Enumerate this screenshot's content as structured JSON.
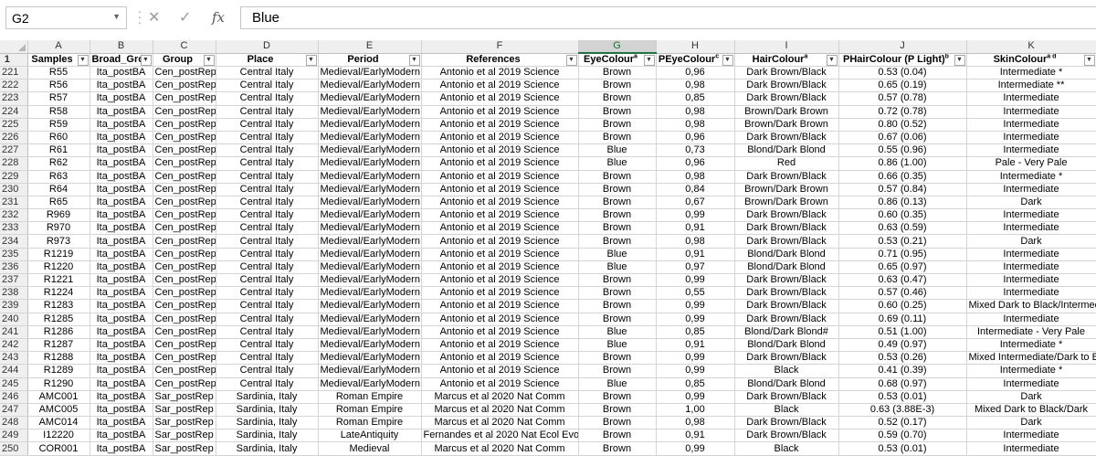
{
  "formula_bar": {
    "name_box": "G2",
    "cancel_icon": "✕",
    "confirm_icon": "✓",
    "fx_label": "fx",
    "value": "Blue"
  },
  "grid": {
    "selected_column": "G",
    "columns": [
      "A",
      "B",
      "C",
      "D",
      "E",
      "F",
      "G",
      "H",
      "I",
      "J",
      "K"
    ],
    "header_row_number": "1",
    "headers": [
      "Samples",
      "Broad_Gro",
      "Group",
      "Place",
      "Period",
      "References",
      "EyeColour",
      "PEyeColour",
      "HairColour",
      "PHairColour (P Light)",
      "SkinColour"
    ],
    "header_superscripts": [
      "",
      "",
      "",
      "",
      "",
      "",
      "a",
      "c",
      "a",
      "b",
      "a d"
    ],
    "rows": [
      [
        "221",
        "R55",
        "Ita_postBA",
        "Cen_postRep",
        "Central Italy",
        "Medieval/EarlyModern",
        "Antonio et al 2019 Science",
        "Brown",
        "0,96",
        "Dark Brown/Black",
        "0.53 (0.04)",
        "Intermediate *"
      ],
      [
        "222",
        "R56",
        "Ita_postBA",
        "Cen_postRep",
        "Central Italy",
        "Medieval/EarlyModern",
        "Antonio et al 2019 Science",
        "Brown",
        "0,98",
        "Dark Brown/Black",
        "0.65 (0.19)",
        "Intermediate **"
      ],
      [
        "223",
        "R57",
        "Ita_postBA",
        "Cen_postRep",
        "Central Italy",
        "Medieval/EarlyModern",
        "Antonio et al 2019 Science",
        "Brown",
        "0,85",
        "Dark Brown/Black",
        "0.57 (0.78)",
        "Intermediate"
      ],
      [
        "224",
        "R58",
        "Ita_postBA",
        "Cen_postRep",
        "Central Italy",
        "Medieval/EarlyModern",
        "Antonio et al 2019 Science",
        "Brown",
        "0,98",
        "Brown/Dark Brown",
        "0.72 (0.78)",
        "Intermediate"
      ],
      [
        "225",
        "R59",
        "Ita_postBA",
        "Cen_postRep",
        "Central Italy",
        "Medieval/EarlyModern",
        "Antonio et al 2019 Science",
        "Brown",
        "0,98",
        "Brown/Dark Brown",
        "0.80 (0.52)",
        "Intermediate"
      ],
      [
        "226",
        "R60",
        "Ita_postBA",
        "Cen_postRep",
        "Central Italy",
        "Medieval/EarlyModern",
        "Antonio et al 2019 Science",
        "Brown",
        "0,96",
        "Dark Brown/Black",
        "0.67 (0.06)",
        "Intermediate"
      ],
      [
        "227",
        "R61",
        "Ita_postBA",
        "Cen_postRep",
        "Central Italy",
        "Medieval/EarlyModern",
        "Antonio et al 2019 Science",
        "Blue",
        "0,73",
        "Blond/Dark Blond",
        "0.55 (0.96)",
        "Intermediate"
      ],
      [
        "228",
        "R62",
        "Ita_postBA",
        "Cen_postRep",
        "Central Italy",
        "Medieval/EarlyModern",
        "Antonio et al 2019 Science",
        "Blue",
        "0,96",
        "Red",
        "0.86 (1.00)",
        "Pale - Very Pale"
      ],
      [
        "229",
        "R63",
        "Ita_postBA",
        "Cen_postRep",
        "Central Italy",
        "Medieval/EarlyModern",
        "Antonio et al 2019 Science",
        "Brown",
        "0,98",
        "Dark Brown/Black",
        "0.66 (0.35)",
        "Intermediate *"
      ],
      [
        "230",
        "R64",
        "Ita_postBA",
        "Cen_postRep",
        "Central Italy",
        "Medieval/EarlyModern",
        "Antonio et al 2019 Science",
        "Brown",
        "0,84",
        "Brown/Dark Brown",
        "0.57 (0.84)",
        "Intermediate"
      ],
      [
        "231",
        "R65",
        "Ita_postBA",
        "Cen_postRep",
        "Central Italy",
        "Medieval/EarlyModern",
        "Antonio et al 2019 Science",
        "Brown",
        "0,67",
        "Brown/Dark Brown",
        "0.86 (0.13)",
        "Dark"
      ],
      [
        "232",
        "R969",
        "Ita_postBA",
        "Cen_postRep",
        "Central Italy",
        "Medieval/EarlyModern",
        "Antonio et al 2019 Science",
        "Brown",
        "0,99",
        "Dark Brown/Black",
        "0.60 (0.35)",
        "Intermediate"
      ],
      [
        "233",
        "R970",
        "Ita_postBA",
        "Cen_postRep",
        "Central Italy",
        "Medieval/EarlyModern",
        "Antonio et al 2019 Science",
        "Brown",
        "0,91",
        "Dark Brown/Black",
        "0.63 (0.59)",
        "Intermediate"
      ],
      [
        "234",
        "R973",
        "Ita_postBA",
        "Cen_postRep",
        "Central Italy",
        "Medieval/EarlyModern",
        "Antonio et al 2019 Science",
        "Brown",
        "0,98",
        "Dark Brown/Black",
        "0.53 (0.21)",
        "Dark"
      ],
      [
        "235",
        "R1219",
        "Ita_postBA",
        "Cen_postRep",
        "Central Italy",
        "Medieval/EarlyModern",
        "Antonio et al 2019 Science",
        "Blue",
        "0,91",
        "Blond/Dark Blond",
        "0.71 (0.95)",
        "Intermediate"
      ],
      [
        "236",
        "R1220",
        "Ita_postBA",
        "Cen_postRep",
        "Central Italy",
        "Medieval/EarlyModern",
        "Antonio et al 2019 Science",
        "Blue",
        "0,97",
        "Blond/Dark Blond",
        "0.65 (0.97)",
        "Intermediate"
      ],
      [
        "237",
        "R1221",
        "Ita_postBA",
        "Cen_postRep",
        "Central Italy",
        "Medieval/EarlyModern",
        "Antonio et al 2019 Science",
        "Brown",
        "0,99",
        "Dark Brown/Black",
        "0.63 (0.47)",
        "Intermediate"
      ],
      [
        "238",
        "R1224",
        "Ita_postBA",
        "Cen_postRep",
        "Central Italy",
        "Medieval/EarlyModern",
        "Antonio et al 2019 Science",
        "Brown",
        "0,55",
        "Dark Brown/Black",
        "0.57 (0.46)",
        "Intermediate"
      ],
      [
        "239",
        "R1283",
        "Ita_postBA",
        "Cen_postRep",
        "Central Italy",
        "Medieval/EarlyModern",
        "Antonio et al 2019 Science",
        "Brown",
        "0,99",
        "Dark Brown/Black",
        "0.60 (0.25)",
        "Mixed Dark to Black/Intermediate"
      ],
      [
        "240",
        "R1285",
        "Ita_postBA",
        "Cen_postRep",
        "Central Italy",
        "Medieval/EarlyModern",
        "Antonio et al 2019 Science",
        "Brown",
        "0,99",
        "Dark Brown/Black",
        "0.69 (0.11)",
        "Intermediate"
      ],
      [
        "241",
        "R1286",
        "Ita_postBA",
        "Cen_postRep",
        "Central Italy",
        "Medieval/EarlyModern",
        "Antonio et al 2019 Science",
        "Blue",
        "0,85",
        "Blond/Dark Blond#",
        "0.51 (1.00)",
        "Intermediate - Very Pale"
      ],
      [
        "242",
        "R1287",
        "Ita_postBA",
        "Cen_postRep",
        "Central Italy",
        "Medieval/EarlyModern",
        "Antonio et al 2019 Science",
        "Blue",
        "0,91",
        "Blond/Dark Blond",
        "0.49 (0.97)",
        "Intermediate *"
      ],
      [
        "243",
        "R1288",
        "Ita_postBA",
        "Cen_postRep",
        "Central Italy",
        "Medieval/EarlyModern",
        "Antonio et al 2019 Science",
        "Brown",
        "0,99",
        "Dark Brown/Black",
        "0.53 (0.26)",
        "Mixed Intermediate/Dark to Black"
      ],
      [
        "244",
        "R1289",
        "Ita_postBA",
        "Cen_postRep",
        "Central Italy",
        "Medieval/EarlyModern",
        "Antonio et al 2019 Science",
        "Brown",
        "0,99",
        "Black",
        "0.41 (0.39)",
        "Intermediate *"
      ],
      [
        "245",
        "R1290",
        "Ita_postBA",
        "Cen_postRep",
        "Central Italy",
        "Medieval/EarlyModern",
        "Antonio et al 2019 Science",
        "Blue",
        "0,85",
        "Blond/Dark Blond",
        "0.68 (0.97)",
        "Intermediate"
      ],
      [
        "246",
        "AMC001",
        "Ita_postBA",
        "Sar_postRep",
        "Sardinia, Italy",
        "Roman Empire",
        "Marcus et al 2020 Nat Comm",
        "Brown",
        "0,99",
        "Dark Brown/Black",
        "0.53 (0.01)",
        "Dark"
      ],
      [
        "247",
        "AMC005",
        "Ita_postBA",
        "Sar_postRep",
        "Sardinia, Italy",
        "Roman Empire",
        "Marcus et al 2020 Nat Comm",
        "Brown",
        "1,00",
        "Black",
        "0.63 (3.88E-3)",
        "Mixed Dark to Black/Dark"
      ],
      [
        "248",
        "AMC014",
        "Ita_postBA",
        "Sar_postRep",
        "Sardinia, Italy",
        "Roman Empire",
        "Marcus et al 2020 Nat Comm",
        "Brown",
        "0,98",
        "Dark Brown/Black",
        "0.52 (0.17)",
        "Dark"
      ],
      [
        "249",
        "I12220",
        "Ita_postBA",
        "Sar_postRep",
        "Sardinia, Italy",
        "LateAntiquity",
        "Fernandes et al 2020 Nat Ecol Evol",
        "Brown",
        "0,91",
        "Dark Brown/Black",
        "0.59 (0.70)",
        "Intermediate"
      ],
      [
        "250",
        "COR001",
        "Ita_postBA",
        "Sar_postRep",
        "Sardinia, Italy",
        "Medieval",
        "Marcus et al 2020 Nat Comm",
        "Brown",
        "0,99",
        "Black",
        "0.53 (0.01)",
        "Intermediate"
      ]
    ]
  },
  "colors": {
    "accent": "#217346",
    "header_bg": "#efefef",
    "gridline": "#d4d4d4"
  }
}
